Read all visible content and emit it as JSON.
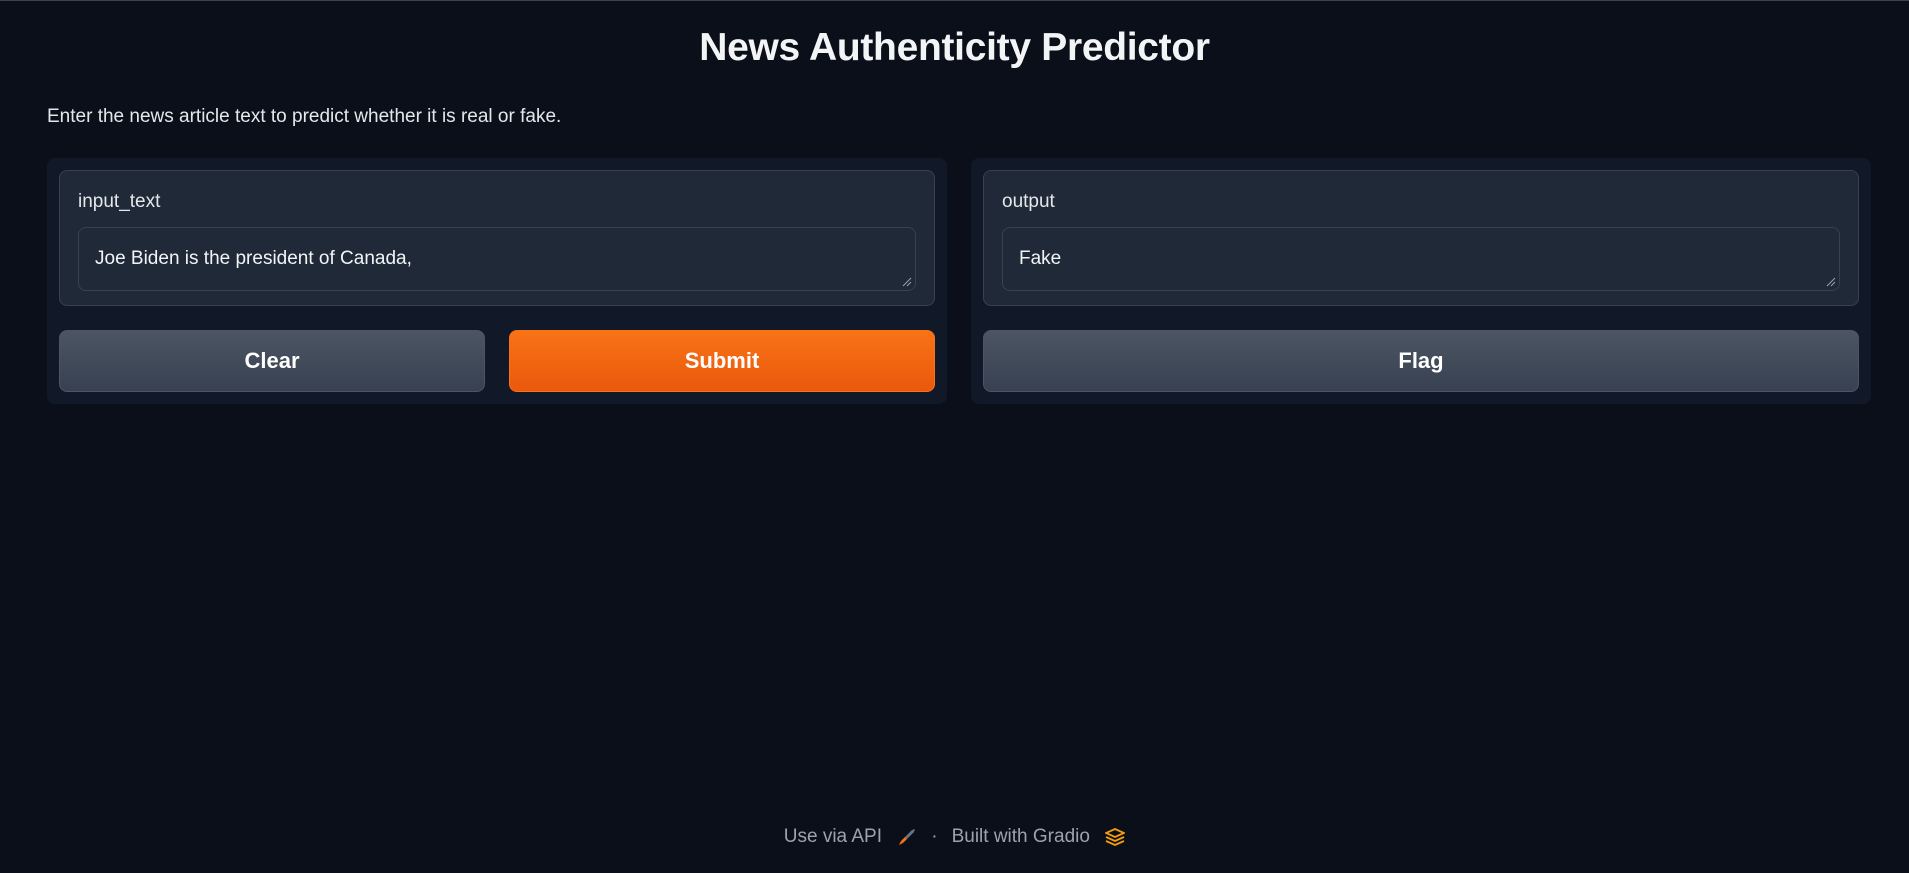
{
  "header": {
    "title": "News Authenticity Predictor",
    "description": "Enter the news article text to predict whether it is real or fake."
  },
  "input": {
    "label": "input_text",
    "value": "Joe Biden is the president of Canada,"
  },
  "output": {
    "label": "output",
    "value": "Fake"
  },
  "buttons": {
    "clear": "Clear",
    "submit": "Submit",
    "flag": "Flag"
  },
  "footer": {
    "api_label": "Use via API",
    "separator": "·",
    "built_with": "Built with Gradio",
    "api_icon": "rocket-icon",
    "gradio_icon": "gradio-logo-icon"
  },
  "colors": {
    "background": "#0b0f19",
    "primary": "#f97316",
    "secondary": "#4b5563"
  }
}
